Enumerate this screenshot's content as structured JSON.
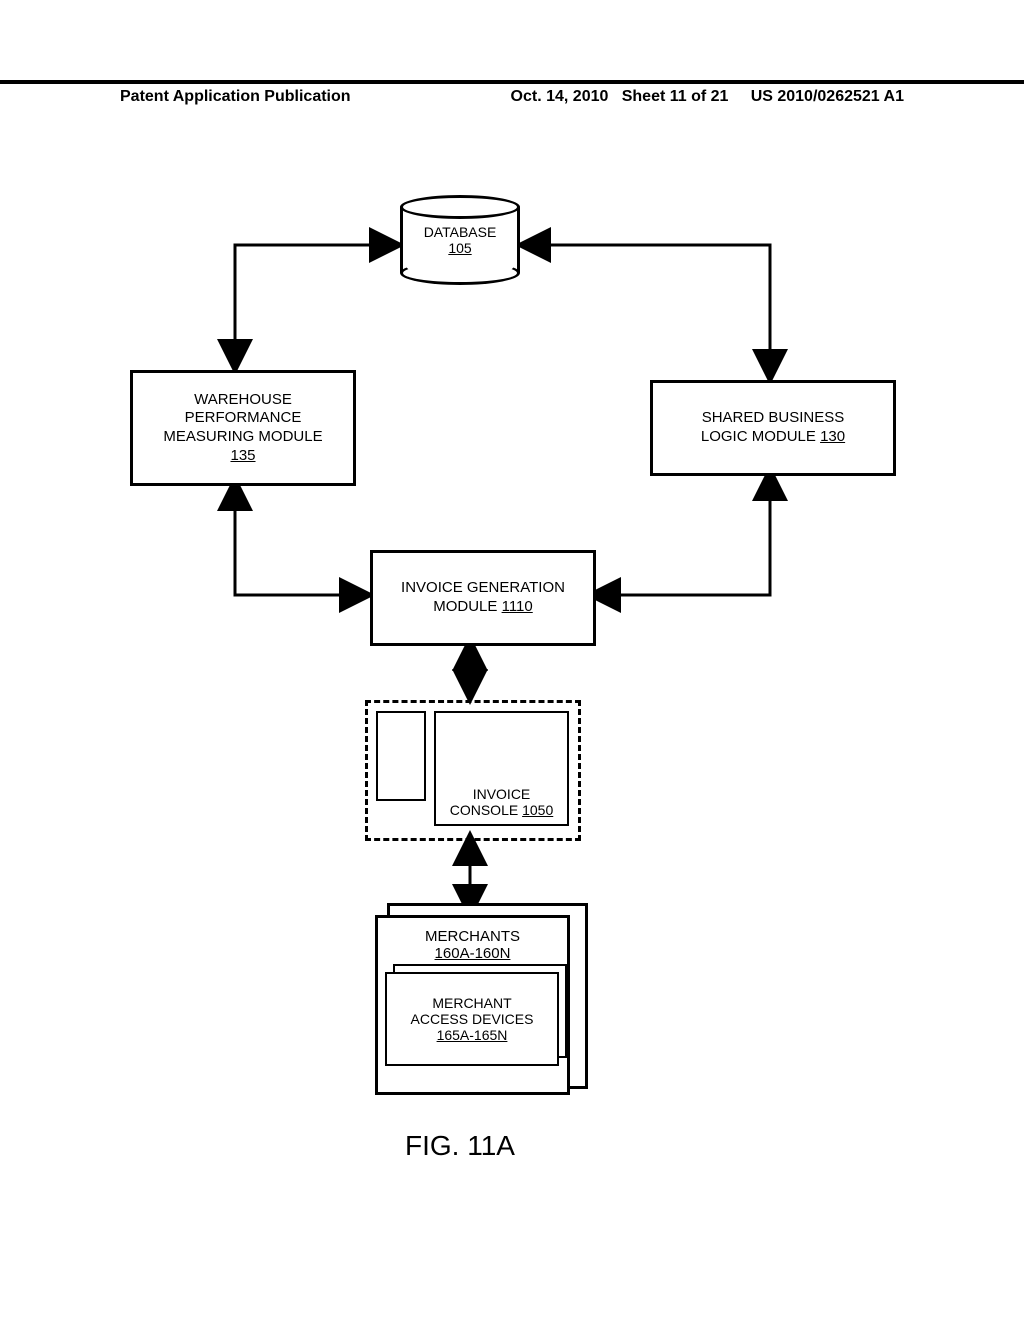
{
  "header": {
    "left": "Patent Application Publication",
    "date": "Oct. 14, 2010",
    "sheet": "Sheet 11 of 21",
    "pubno": "US 2010/0262521 A1"
  },
  "database": {
    "label": "DATABASE",
    "num": "105"
  },
  "warehouse": {
    "l1": "WAREHOUSE",
    "l2": "PERFORMANCE",
    "l3": "MEASURING MODULE",
    "num": "135"
  },
  "shared": {
    "l1": "SHARED BUSINESS",
    "l2": "LOGIC MODULE",
    "num": "130"
  },
  "invoice_gen": {
    "l1": "INVOICE GENERATION",
    "l2": "MODULE",
    "num": "1110"
  },
  "console": {
    "l1": "INVOICE",
    "l2": "CONSOLE",
    "num": "1050"
  },
  "merchants": {
    "label": "MERCHANTS",
    "num": "160A-160N",
    "dev_l1": "MERCHANT",
    "dev_l2": "ACCESS DEVICES",
    "dev_num": "165A-165N"
  },
  "figure": "FIG. 11A"
}
